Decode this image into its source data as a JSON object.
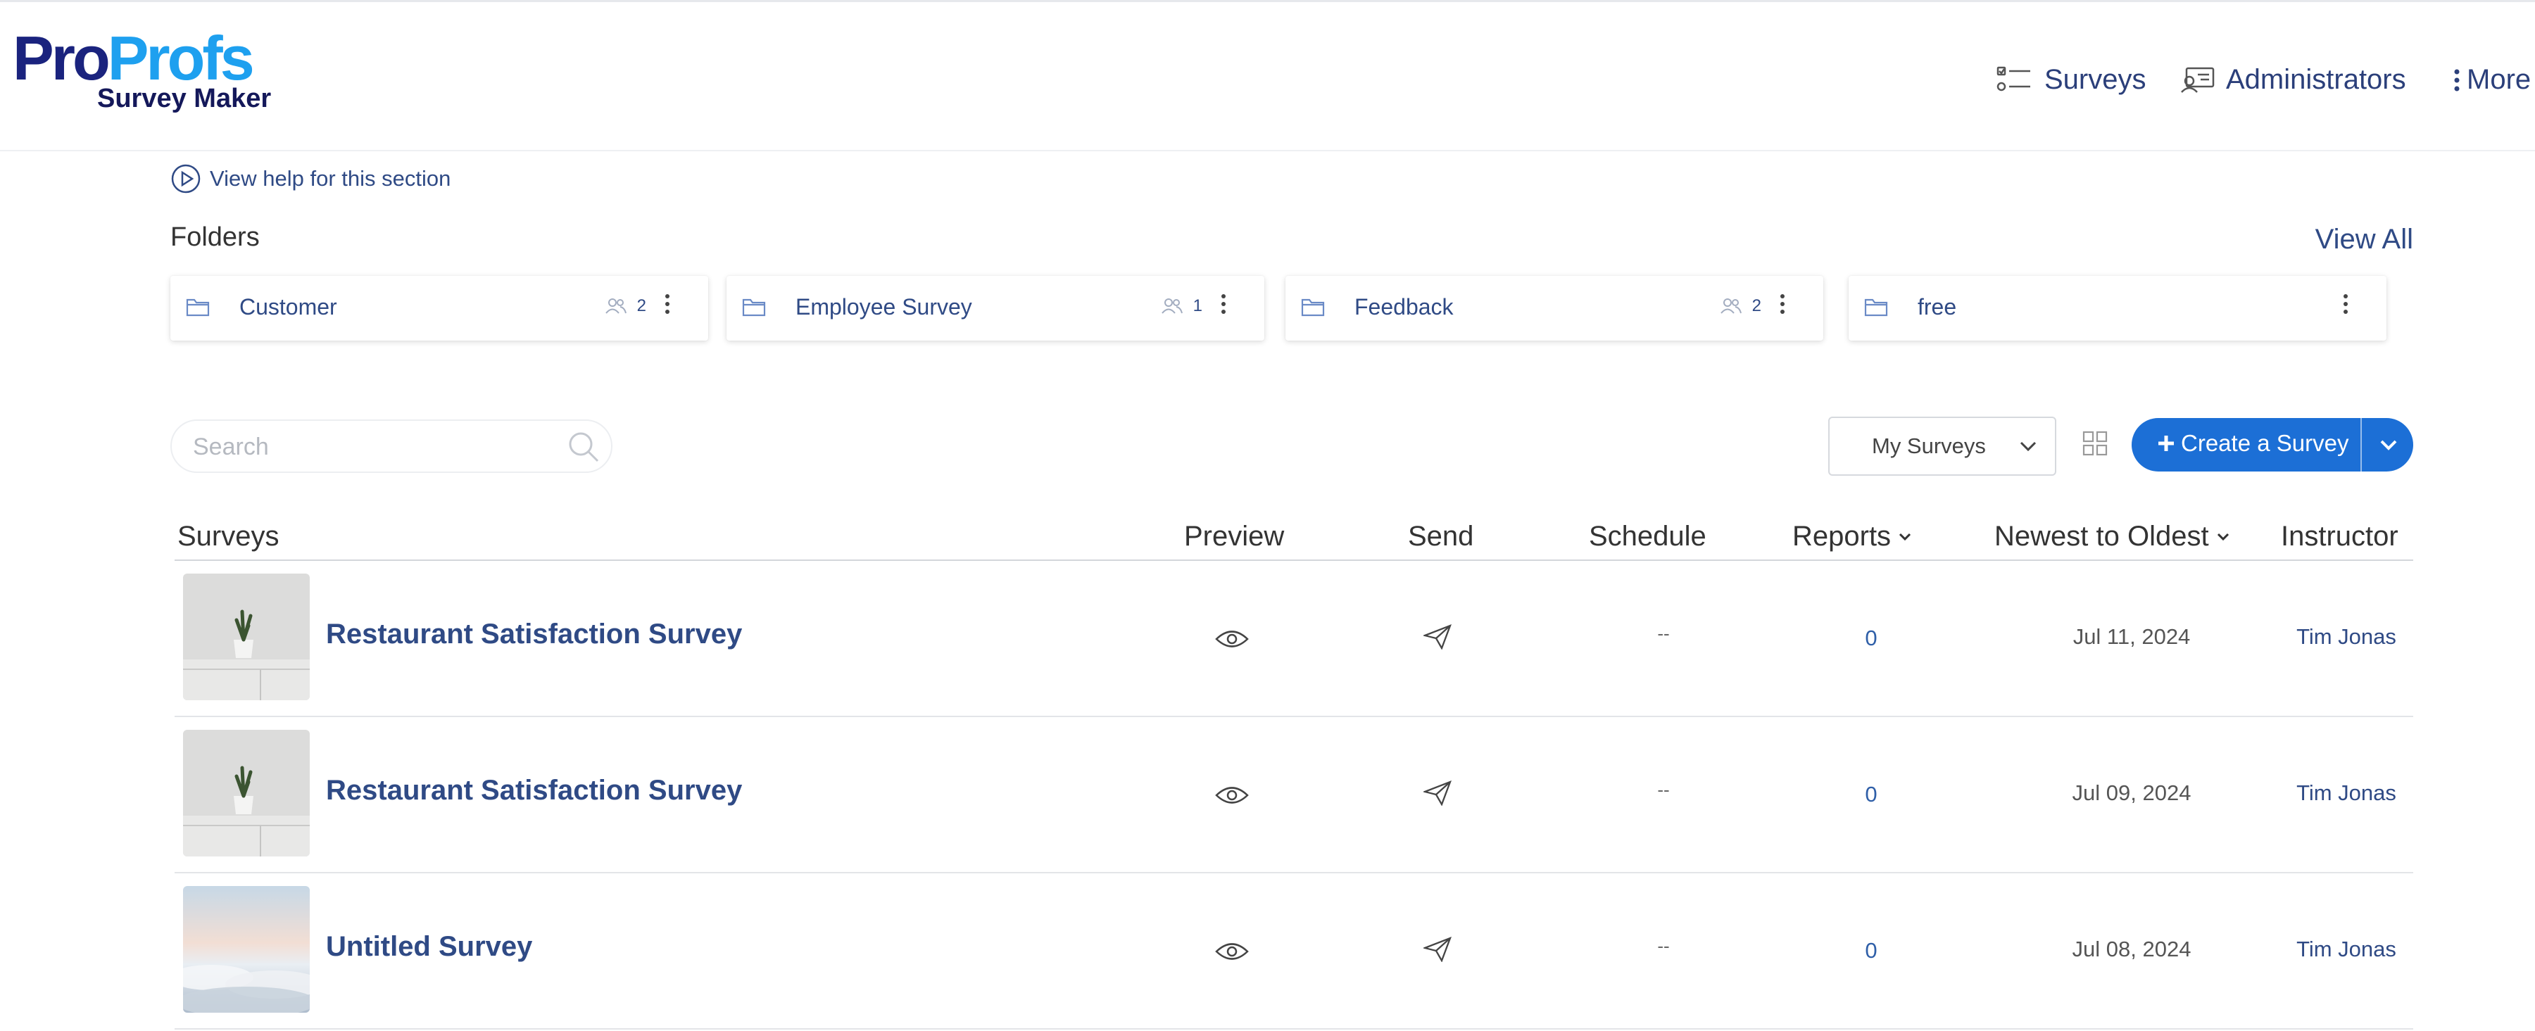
{
  "logo": {
    "part1": "Pro",
    "part2": "Profs",
    "subtitle": "Survey Maker"
  },
  "nav": {
    "surveys": "Surveys",
    "administrators": "Administrators",
    "more": "More"
  },
  "help": {
    "text": "View help for this section"
  },
  "folders": {
    "title": "Folders",
    "view_all": "View All",
    "items": [
      {
        "name": "Customer",
        "count": "2"
      },
      {
        "name": "Employee Survey",
        "count": "1"
      },
      {
        "name": "Feedback",
        "count": "2"
      },
      {
        "name": "free",
        "count": ""
      }
    ]
  },
  "toolbar": {
    "search_placeholder": "Search",
    "filter_value": "My Surveys",
    "create_label": "Create a Survey"
  },
  "table": {
    "headers": {
      "surveys": "Surveys",
      "preview": "Preview",
      "send": "Send",
      "schedule": "Schedule",
      "reports": "Reports",
      "sort": "Newest to Oldest",
      "instructor": "Instructor"
    },
    "rows": [
      {
        "title": "Restaurant Satisfaction Survey",
        "schedule": "--",
        "reports": "0",
        "date": "Jul 11, 2024",
        "instructor": "Tim Jonas",
        "thumb": "plant"
      },
      {
        "title": "Restaurant Satisfaction Survey",
        "schedule": "--",
        "reports": "0",
        "date": "Jul 09, 2024",
        "instructor": "Tim Jonas",
        "thumb": "plant"
      },
      {
        "title": "Untitled Survey",
        "schedule": "--",
        "reports": "0",
        "date": "Jul 08, 2024",
        "instructor": "Tim Jonas",
        "thumb": "clouds"
      }
    ]
  },
  "colors": {
    "primary": "#1c6fd6",
    "link": "#2f4a85",
    "logo_dark": "#1a237e",
    "logo_light": "#1ea0ef"
  }
}
